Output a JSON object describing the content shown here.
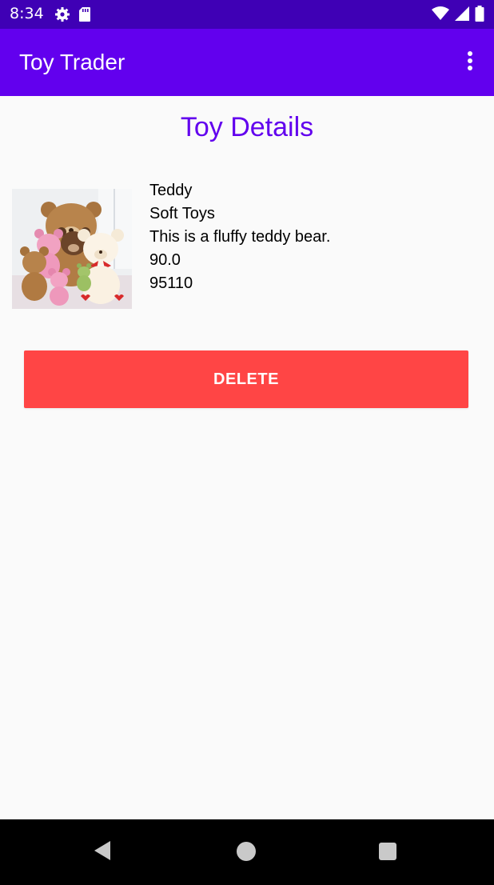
{
  "status_bar": {
    "time": "8:34",
    "icons": [
      "settings-icon",
      "sd-card-icon",
      "wifi-icon",
      "signal-icon",
      "battery-icon"
    ]
  },
  "app_bar": {
    "title": "Toy Trader",
    "overflow_icon": "more-vert-icon"
  },
  "page": {
    "title": "Toy Details"
  },
  "toy": {
    "name": "Teddy",
    "category": "Soft Toys",
    "description": "This is a fluffy teddy bear.",
    "price": "90.0",
    "zip": "95110",
    "image": "teddy-bears-photo"
  },
  "actions": {
    "delete_label": "DELETE"
  },
  "nav_bar": {
    "icons": [
      "back-icon",
      "home-icon",
      "recents-icon"
    ]
  },
  "colors": {
    "status_bar": "#3f00b5",
    "app_bar": "#6200ee",
    "title": "#6200ee",
    "delete": "#ff4545",
    "background": "#fafafa"
  }
}
